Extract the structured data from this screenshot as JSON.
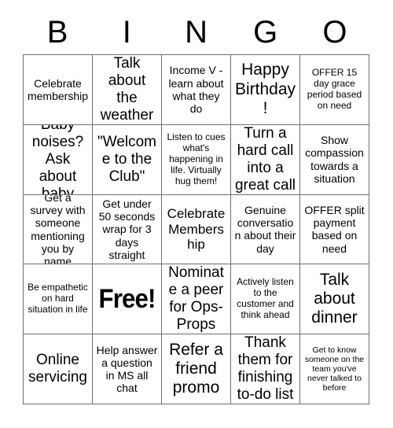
{
  "card": {
    "header_letters": [
      "B",
      "I",
      "N",
      "G",
      "O"
    ],
    "rows": [
      [
        {
          "text": "Celebrate membership",
          "size": "md"
        },
        {
          "text": "Talk about the weather",
          "size": "xl"
        },
        {
          "text": "Income V - learn about what they do",
          "size": "md"
        },
        {
          "text": "Happy Birthday!",
          "size": "xxl"
        },
        {
          "text": "OFFER 15 day grace period based on need",
          "size": "sm"
        }
      ],
      [
        {
          "text": "Baby noises? Ask about baby",
          "size": "xl"
        },
        {
          "text": "\"Welcome to the Club\"",
          "size": "xl"
        },
        {
          "text": "Listen to cues what's happening in life. Virtually hug them!",
          "size": "sm"
        },
        {
          "text": "Turn a hard call into a great call",
          "size": "xl"
        },
        {
          "text": "Show compassion towards a situation",
          "size": "md"
        }
      ],
      [
        {
          "text": "Get a survey with someone mentioning you by name",
          "size": "md"
        },
        {
          "text": "Get under 50 seconds wrap for 3 days straight",
          "size": "md"
        },
        {
          "text": "Celebrate Membership",
          "size": "lg"
        },
        {
          "text": "Genuine conversation about their day",
          "size": "md"
        },
        {
          "text": "OFFER split payment based on need",
          "size": "md"
        }
      ],
      [
        {
          "text": "Be empathetic on hard situation in life",
          "size": "sm"
        },
        {
          "text": "Free!",
          "size": "free"
        },
        {
          "text": "Nominate a peer for Ops-Props",
          "size": "xl"
        },
        {
          "text": "Actively listen to the customer and think ahead",
          "size": "sm"
        },
        {
          "text": "Talk about dinner",
          "size": "xxl"
        }
      ],
      [
        {
          "text": "Online servicing",
          "size": "xl"
        },
        {
          "text": "Help answer a question in MS all chat",
          "size": "md"
        },
        {
          "text": "Refer a friend promo",
          "size": "xxl"
        },
        {
          "text": "Thank them for finishing to-do list",
          "size": "xl"
        },
        {
          "text": "Get to know someone on the team you've never talked to before",
          "size": "xs"
        }
      ]
    ]
  }
}
